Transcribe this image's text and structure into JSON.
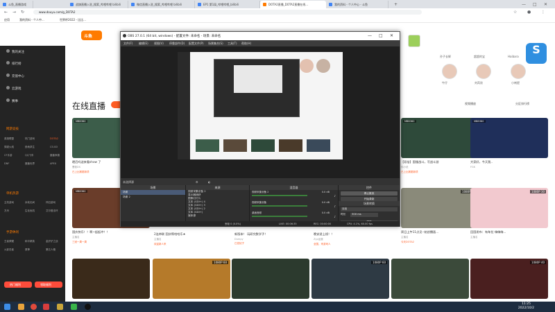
{
  "browser": {
    "tabs": [
      {
        "label": "斗鱼_直播游戏"
      },
      {
        "label": "战旗直播入驻_搜索_哔哩哔哩 bilibili"
      },
      {
        "label": "微信直播入驻_搜索_哔哩哔哩 bilibili"
      },
      {
        "label": "EP1 第1局_哔哩哔哩_bilibili"
      },
      {
        "label": "DOTA2直播_DOTA2直播在线..."
      },
      {
        "label": "我的资料 - 个人中心 - 斗鱼"
      }
    ],
    "url": "www.douyu.com/g_DOTA2",
    "bookmarks": [
      "应用",
      "我的资料 - 个人中...",
      "世界杯2022 - 比比..."
    ]
  },
  "sidebar": {
    "items": [
      "我的关注",
      "排行榜",
      "充值中心",
      "云游戏",
      "赛事"
    ],
    "sections": [
      {
        "title": "网游竞技",
        "subs": [
          "英雄联盟",
          "热门游戏",
          "DOTA2",
          "穿越火线",
          "绝地求生",
          "CS:GO",
          "CF手游",
          "QQ飞车",
          "魔兽争霸",
          "DNF",
          "魔兽世界",
          "APEX"
        ]
      },
      {
        "title": "单机热游",
        "subs": [
          "主机游戏",
          "永劫无间",
          "怀旧游戏",
          "方舟",
          "生化危机",
          "艾尔登法环"
        ]
      },
      {
        "title": "手游休闲",
        "subs": [
          "王者荣耀",
          "和平精英",
          "金铲铲之战",
          "火影忍者",
          "原神",
          "第五人格"
        ]
      }
    ],
    "btn1": "热门福利",
    "btn2": "领取福利"
  },
  "header": {
    "logo": "斗鱼",
    "live_title": "在线直播",
    "right_links": [
      "视频播放",
      "分区排行榜"
    ],
    "avatars": [
      "孙子长辉",
      "超超的宝",
      "Haibara",
      "牛仔",
      "刘芮欣",
      "小刺提"
    ]
  },
  "cards": [
    {
      "title": "晒后吗送来看show 了",
      "meta": "曹毅DS",
      "tag": "已上比赛更新项",
      "hd": "",
      "hdl": "MBB360"
    },
    {
      "title": "【双倍】国服战斗，写战斗游",
      "meta": "你小说",
      "tag": "已上比赛更新项",
      "hd": "",
      "hdl": "MBB360"
    },
    {
      "title": "大家好，今天我..",
      "meta": "FGK",
      "tag": "",
      "hd": "",
      "hdl": "MBB360"
    },
    {
      "title": "国庆快乐！！啊~起起冲！！",
      "meta": "主播名",
      "tag": "三冠一周一周",
      "hd": "1080P 60",
      "hdl": "MBB360"
    },
    {
      "title": "2连串联 国庆啊哈哈乐★",
      "meta": "主播名",
      "tag": "欢迎新人来",
      "hd": "",
      "hdl": ""
    },
    {
      "title": "新版本！ 玩研究数学子！",
      "meta": "Dumpy",
      "tag": "已发帖子",
      "hd": "",
      "hdl": ""
    },
    {
      "title": "晚安游上线！！",
      "meta": "Zyp运营",
      "tag": "全国，来游戏人",
      "hd": "1080P 60",
      "hdl": ""
    },
    {
      "title": "周日上午11点见--始创播画...",
      "meta": "主播名",
      "tag": "今天DOTA2",
      "hd": "1080P 40",
      "hdl": ""
    },
    {
      "title": "回国发布：有车拉 嗨嗨嗨...",
      "meta": "主播名",
      "tag": "",
      "hd": "1080P 30",
      "hdl": ""
    },
    {
      "title": "",
      "meta": "",
      "tag": "",
      "hd": "1080P 60",
      "hdl": ""
    },
    {
      "title": "",
      "meta": "",
      "tag": "",
      "hd": "1080P 60",
      "hdl": ""
    },
    {
      "title": "",
      "meta": "",
      "tag": "",
      "hd": "1080P 40",
      "hdl": ""
    }
  ],
  "obs": {
    "title": "OBS 27.0.1 (64 bit, windows) - 配置文件: 未命名 - 场景: 未命名",
    "menu": [
      "文件(F)",
      "编辑(E)",
      "视图(V)",
      "停靠部件(D)",
      "配置文件(P)",
      "场景集合(S)",
      "工具(T)",
      "帮助(H)"
    ],
    "status_line": "未选择源",
    "docks": {
      "scenes": {
        "title": "场景",
        "items": [
          "场景",
          "场景 2"
        ]
      },
      "sources": {
        "title": "来源",
        "items": [
          "视频采集设备 2",
          "显示器捕获",
          "图像幻灯片",
          "文本 (GDI+) 4",
          "文本 (GDI+) 3",
          "文本 (GDI+) 2",
          "文本 (GDI+)",
          "媒体源",
          "VLC 视频源",
          "窗口捕获 2",
          "文本 (GDI+) 5"
        ]
      },
      "mixer": {
        "title": "混音器",
        "rows": [
          {
            "name": "视频采集设备 2",
            "db": "0.0 dB"
          },
          {
            "name": "视频采集设备",
            "db": "0.0 dB"
          },
          {
            "name": "桌面音频",
            "db": "0.0 dB"
          }
        ]
      },
      "controls": {
        "title": "控件",
        "buttons": [
          "停止推流",
          "开始录制",
          "启动虚拟摄像机",
          "工作室模式",
          "设置",
          "退出"
        ]
      },
      "transitions": {
        "title": "场景转换",
        "mode": "淡出",
        "duration_label": "时长",
        "duration": "300 ms"
      }
    },
    "status": {
      "live": "LIVE: 00:06:35",
      "rec": "REC: 00:00:00",
      "cpu": "CPU: 4.1%, 60.00 fps",
      "dropped": "丢帧 0 (0.0%)"
    }
  },
  "taskbar": {
    "time": "11:25",
    "date": "2022/10/2"
  }
}
